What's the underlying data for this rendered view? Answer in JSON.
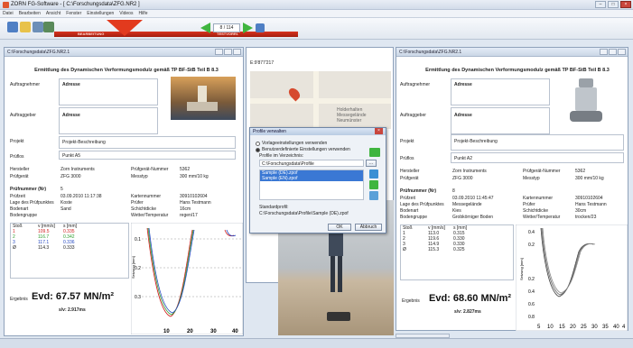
{
  "app": {
    "title": "ZORN FG-Software - [ C:\\Forschungsdata\\ZFG.NR2 ]"
  },
  "menu": [
    "Datei",
    "Bearbeiten",
    "Ansicht",
    "Fenster",
    "Einstellungen",
    "Videos",
    "Hilfe"
  ],
  "toolbar": {
    "left_label": "BEARBEITUNG",
    "right_label": "TESTVORRI.",
    "page_indicator": "8 / 114"
  },
  "left_window": {
    "title": "C:\\Forschungsdata\\ZFG.NR2.1",
    "heading": "Ermittlung des Dynamischen Verformungsmodulz gemäß TP BF-StB Teil B 8.3",
    "auftragnehmer_label": "Auftragnehmer",
    "auftragnehmer_value": "Adresse",
    "auftraggeber_label": "Auftraggeber",
    "auftraggeber_value": "Adresse",
    "projekt_label": "Projekt",
    "projekt_value": "Projekt-Beschreibung",
    "pruffeld_label": "Prüflos",
    "pruffeld_value": "Punkt A5",
    "hersteller_label": "Hersteller",
    "hersteller_value": "Zorn Instruments",
    "prufgerat_label": "Prüfgerät",
    "prufgerat_value": "ZFG 3000",
    "pgnr_label": "Prüfgerät-Nummer",
    "pgnr_value": "5362",
    "messtyp_label": "Messtyp",
    "messtyp_value": "300 mm/10 kg",
    "prufnr_label": "Prüfnummer (Nr)",
    "prufnr_value": "5",
    "prufzeit_label": "Prüfzeit",
    "prufzeit_value": "03.09.2010 11:17:38",
    "lage_label": "Lage des Prüfpunktes",
    "lage_value": "Koste",
    "bodenart_label": "Bodenart",
    "bodenart_value": "Sand",
    "bodengruppe_label": "Bodengruppe",
    "kartennr_label": "Kartennummer",
    "kartennr_value": "30910102604",
    "prufer_label": "Prüfer",
    "prufer_value": "Hans Testmann",
    "schicht_label": "Schichtdicke",
    "schicht_value": "16cm",
    "wetter_label": "Wetter/Temperatur",
    "wetter_value": "regen/17",
    "table_headers": [
      "Stoß",
      "v [mm/s]",
      "s [mm]"
    ],
    "table_rows": [
      [
        "1",
        "109.5",
        "0.335"
      ],
      [
        "2",
        "116.7",
        "0.342"
      ],
      [
        "3",
        "117.1",
        "0.336"
      ],
      [
        "Ø",
        "114.3",
        "0.333"
      ]
    ],
    "ergebnis_label": "Ergebnis",
    "evd": "Evd: 67.57 MN/m²",
    "sv": "s/v: 2.917ms",
    "chart_ylabel": "Setzung [mm]",
    "chart_yticks": [
      "0.1",
      "0.2",
      "0.3"
    ],
    "chart_xticks": [
      "10",
      "20",
      "30",
      "40"
    ]
  },
  "middle": {
    "coords": "E:9'877'217",
    "map_text": [
      "Holderhalten",
      "Messegelände",
      "Neumünster"
    ]
  },
  "dialog": {
    "title": "Profile verwalten",
    "radio1": "Vorlageeinstellungen verwenden",
    "radio2": "Benutzerdefinierte Einstellungen verwenden",
    "path_label": "Profile im Verzeichnis:",
    "path_value": "C:\\Forschungsdata\\Profile",
    "path_btn": "...",
    "list_items": [
      "Sample (DE).zpof",
      "Sample (EN).zpof"
    ],
    "standard_label": "Standardprofil:",
    "standard_value": "C:\\Forschungsdata\\Profile\\Sample (DE).zpof",
    "ok": "OK",
    "cancel": "Abbruch"
  },
  "right_window": {
    "title": "C:\\Forschungsdata\\ZFG.NR2.1",
    "heading": "Ermittlung des Dynamischen Verformungsmodulz gemäß TP BF-StB Teil B 8.3",
    "auftragnehmer_label": "Auftragnehmer",
    "auftragnehmer_value": "Adresse",
    "auftraggeber_label": "Auftraggeber",
    "auftraggeber_value": "Adresse",
    "projekt_label": "Projekt",
    "projekt_value": "Projekt-Beschreibung",
    "pruffeld_label": "Prüflos",
    "pruffeld_value": "Punkt A2",
    "hersteller_label": "Hersteller",
    "hersteller_value": "Zorn Instruments",
    "prufgerat_label": "Prüfgerät",
    "prufgerat_value": "ZFG 3000",
    "pgnr_label": "Prüfgerät-Nummer",
    "pgnr_value": "5362",
    "messtyp_label": "Messtyp",
    "messtyp_value": "300 mm/10 kg",
    "prufnr_label": "Prüfnummer (Nr)",
    "prufnr_value": "8",
    "prufzeit_label": "Prüfzeit",
    "prufzeit_value": "03.09.2010 11:45:47",
    "lage_label": "Lage des Prüfpunktes",
    "lage_value": "Messegelände",
    "bodenart_label": "Bodenart",
    "bodenart_value": "Kies",
    "bodengruppe_label": "Bodengruppe",
    "bodengruppe_value": "Grobkörniger Boden",
    "kartennr_label": "Kartennummer",
    "kartennr_value": "30910102604",
    "prufer_label": "Prüfer",
    "prufer_value": "Hans Testmann",
    "schicht_label": "Schichtdicke",
    "schicht_value": "30cm",
    "wetter_label": "Wetter/Temperatur",
    "wetter_value": "trocken/23",
    "table_headers": [
      "Stoß",
      "v [mm/s]",
      "s [mm]"
    ],
    "table_rows": [
      [
        "1",
        "113.0",
        "0.315"
      ],
      [
        "2",
        "119.6",
        "0.330"
      ],
      [
        "3",
        "114.9",
        "0.330"
      ],
      [
        "Ø",
        "115.3",
        "0.325"
      ]
    ],
    "ergebnis_label": "Ergebnis",
    "evd": "Evd: 68.60 MN/m²",
    "sv": "s/v: 2.827ms",
    "chart_ylabel": "Setzung [mm]",
    "chart_yticks": [
      "0.4",
      "0.2",
      "0.2",
      "0.4",
      "0.6",
      "0.8"
    ],
    "chart_xticks": [
      "5",
      "10",
      "15",
      "20",
      "25",
      "30",
      "35",
      "40",
      "4"
    ]
  },
  "colors": {
    "accent_red": "#e23a1e",
    "nav_green": "#3fb53f"
  }
}
